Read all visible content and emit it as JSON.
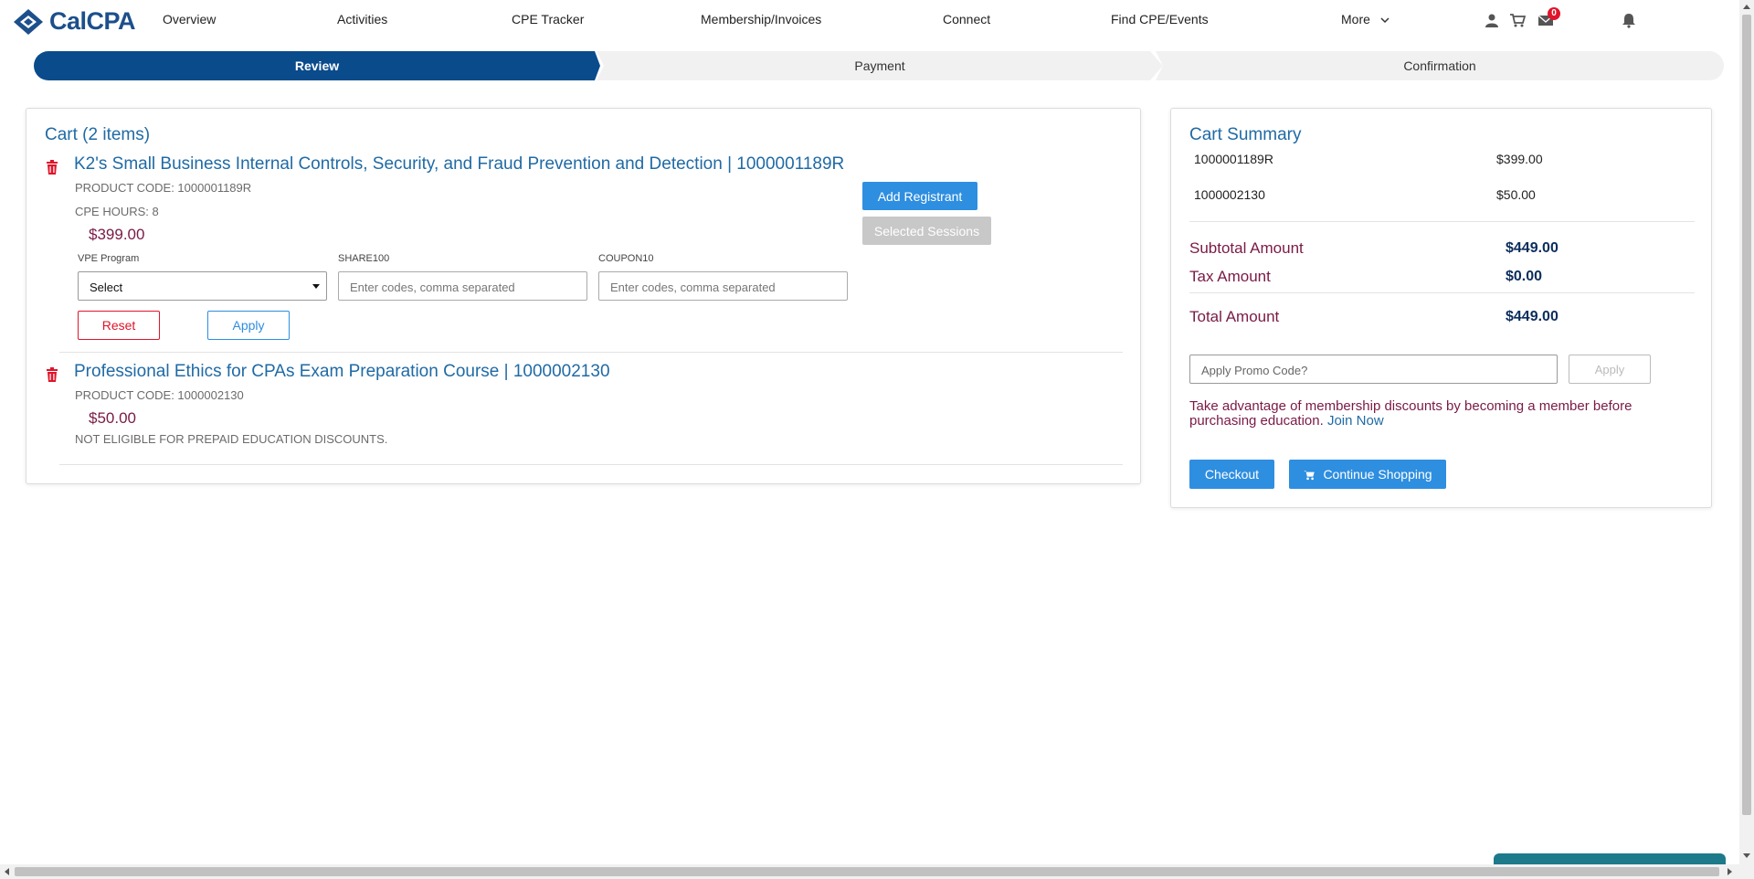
{
  "brand": {
    "name": "CalCPA",
    "color": "#1c4f8c"
  },
  "nav": {
    "items": [
      "Overview",
      "Activities",
      "CPE Tracker",
      "Membership/Invoices",
      "Connect",
      "Find CPE/Events",
      "More"
    ],
    "icons": [
      "user-icon",
      "cart-icon",
      "mail-icon",
      "bell-icon"
    ],
    "mail_count": "0"
  },
  "steps": {
    "review": "Review",
    "payment": "Payment",
    "confirmation": "Confirmation",
    "active_color": "#0a4b8c"
  },
  "cart": {
    "title": "Cart (2 items)",
    "items": [
      {
        "title": "K2's Small Business Internal Controls, Security, and Fraud Prevention and Detection | 1000001189R",
        "product_code": "PRODUCT CODE: 1000001189R",
        "cpe_hours": "CPE HOURS: 8",
        "price": "$399.00",
        "vpe_label": "VPE Program",
        "vpe_value": "Select",
        "share_label": "SHARE100",
        "share_placeholder": "Enter codes, comma separated",
        "coupon_label": "COUPON10",
        "coupon_placeholder": "Enter codes, comma separated",
        "reset_label": "Reset",
        "apply_label": "Apply",
        "add_registrant_label": "Add Registrant",
        "selected_sessions_label": "Selected Sessions"
      },
      {
        "title": "Professional Ethics for CPAs Exam Preparation Course | 1000002130",
        "product_code": "PRODUCT CODE: 1000002130",
        "price": "$50.00",
        "note": "NOT ELIGIBLE FOR PREPAID EDUCATION DISCOUNTS."
      }
    ]
  },
  "summary": {
    "title": "Cart Summary",
    "lines": [
      {
        "code": "1000001189R",
        "amount": "$399.00"
      },
      {
        "code": "1000002130",
        "amount": "$50.00"
      }
    ],
    "subtotal_label": "Subtotal Amount",
    "subtotal_value": "$449.00",
    "tax_label": "Tax Amount",
    "tax_value": "$0.00",
    "total_label": "Total Amount",
    "total_value": "$449.00",
    "promo_placeholder": "Apply Promo Code?",
    "promo_apply_label": "Apply",
    "member_note": "Take advantage of membership discounts by becoming a member before purchasing education.",
    "join_label": "Join Now",
    "checkout_label": "Checkout",
    "continue_label": "Continue Shopping"
  },
  "colors": {
    "accent": "#2e8ee0",
    "price": "#7a1a45",
    "link": "#1f6aa5",
    "danger": "#e0142a"
  }
}
